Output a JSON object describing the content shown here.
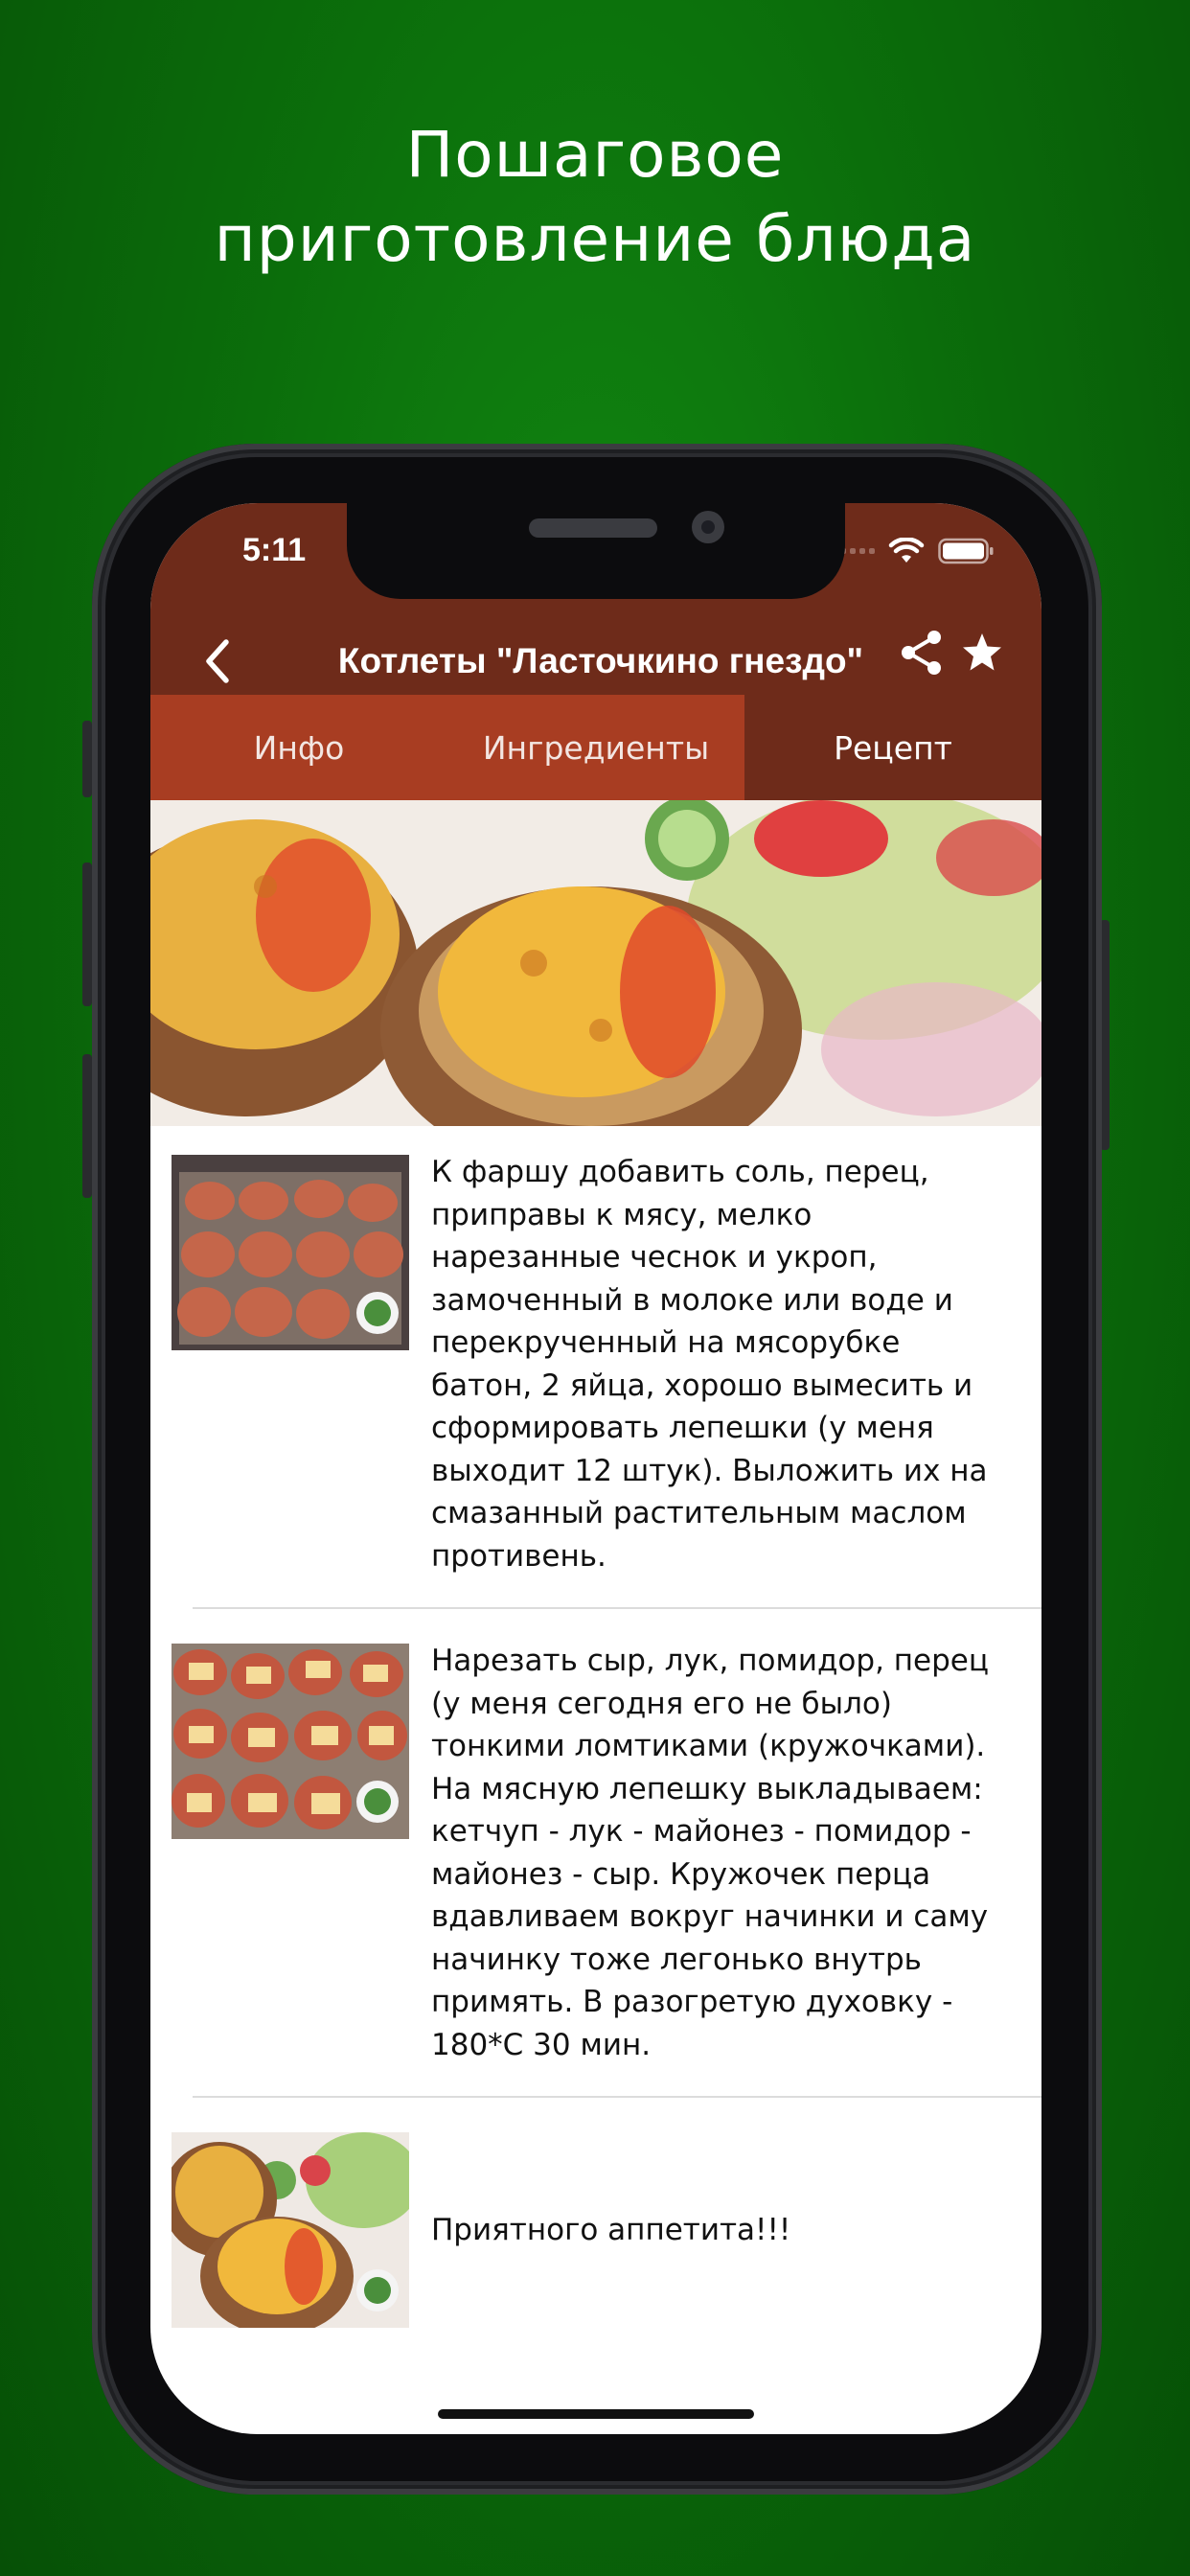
{
  "promo": {
    "line1": "Пошаговое",
    "line2": "приготовление блюда"
  },
  "status_bar": {
    "time": "5:11",
    "icons": [
      "signal-icon",
      "wifi-icon",
      "battery-icon"
    ]
  },
  "nav": {
    "title": "Котлеты \"Ласточкино гнездо\"",
    "back_icon": "chevron-left-icon",
    "share_icon": "share-icon",
    "favorite_icon": "star-icon"
  },
  "tabs": [
    {
      "label": "Инфо"
    },
    {
      "label": "Ингредиенты"
    },
    {
      "label": "Рецепт"
    }
  ],
  "steps": [
    {
      "text": "К фаршу добавить соль, перец, приправы к мясу, мелко нарезанные чеснок и укроп, замоченный в молоке или воде и перекрученный на мясорубке батон, 2 яйца, хорошо вымесить и сформировать лепешки (у меня выходит 12 штук). Выложить их на смазанный растительным маслом противень."
    },
    {
      "text": "Нарезать сыр, лук, помидор, перец (у меня сегодня его не было) тонкими ломтиками (кружочками). На мясную лепешку выкладываем: кетчуп - лук - майонез - помидор - майонез - сыр. Кружочек перца вдавливаем вокруг начинки и саму начинку тоже легонько внутрь примять. В разогретую духовку - 180*С 30 мин."
    },
    {
      "text": "Приятного аппетита!!!"
    }
  ],
  "colors": {
    "background": "#0b6e0b",
    "appbar": "#6e2b1a",
    "tab_highlight": "#a83d22"
  }
}
